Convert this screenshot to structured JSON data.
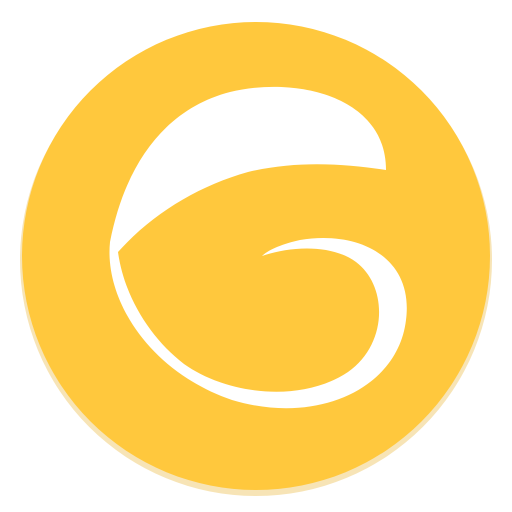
{
  "icon": {
    "name": "app-logo-icon",
    "colors": {
      "badge": "#FFC83D",
      "badge_shadow": "#E8B22E",
      "glyph": "#FFFFFF"
    }
  }
}
